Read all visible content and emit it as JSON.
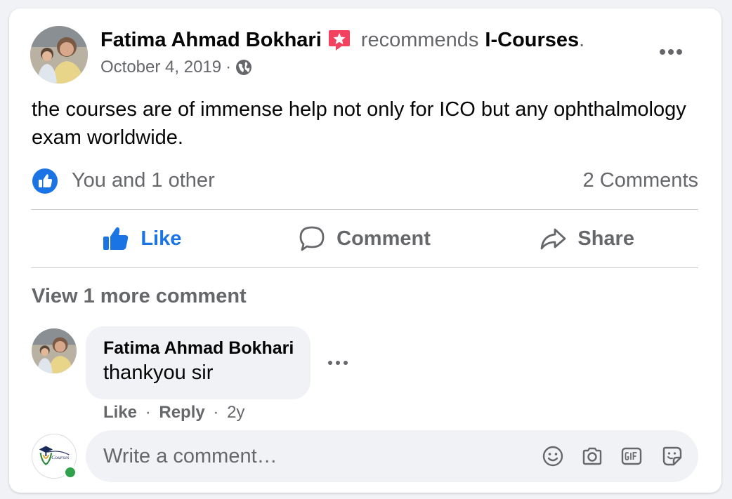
{
  "post": {
    "author": "Fatima Ahmad Bokhari",
    "action": "recommends",
    "page": "I-Courses",
    "page_suffix": ".",
    "date": "October 4, 2019",
    "date_sep": "·",
    "text": "the courses are of immense help not only for ICO but any ophthalmology exam worldwide.",
    "reactions_text": "You and 1 other",
    "comments_count": "2 Comments"
  },
  "actions": {
    "like": "Like",
    "comment": "Comment",
    "share": "Share"
  },
  "comments": {
    "view_more": "View 1 more comment",
    "items": [
      {
        "author": "Fatima Ahmad Bokhari",
        "text": "thankyou sir",
        "like": "Like",
        "reply": "Reply",
        "sep": "·",
        "age": "2y"
      }
    ]
  },
  "composer": {
    "placeholder": "Write a comment…",
    "avatar_logo_text": "Courses"
  },
  "colors": {
    "accent": "#1b74e4",
    "secondary_text": "#65676b",
    "bubble_bg": "#f0f2f5",
    "recommend_badge": "#f3425f",
    "online": "#31a24c"
  },
  "icons": {
    "recommend": "recommend-star-icon",
    "audience": "globe-icon",
    "reaction": "like-reaction-icon",
    "like": "thumbs-up-icon",
    "comment": "speech-bubble-icon",
    "share": "share-arrow-icon",
    "emoji": "smiley-icon",
    "camera": "camera-icon",
    "gif": "gif-icon",
    "sticker": "sticker-icon"
  }
}
